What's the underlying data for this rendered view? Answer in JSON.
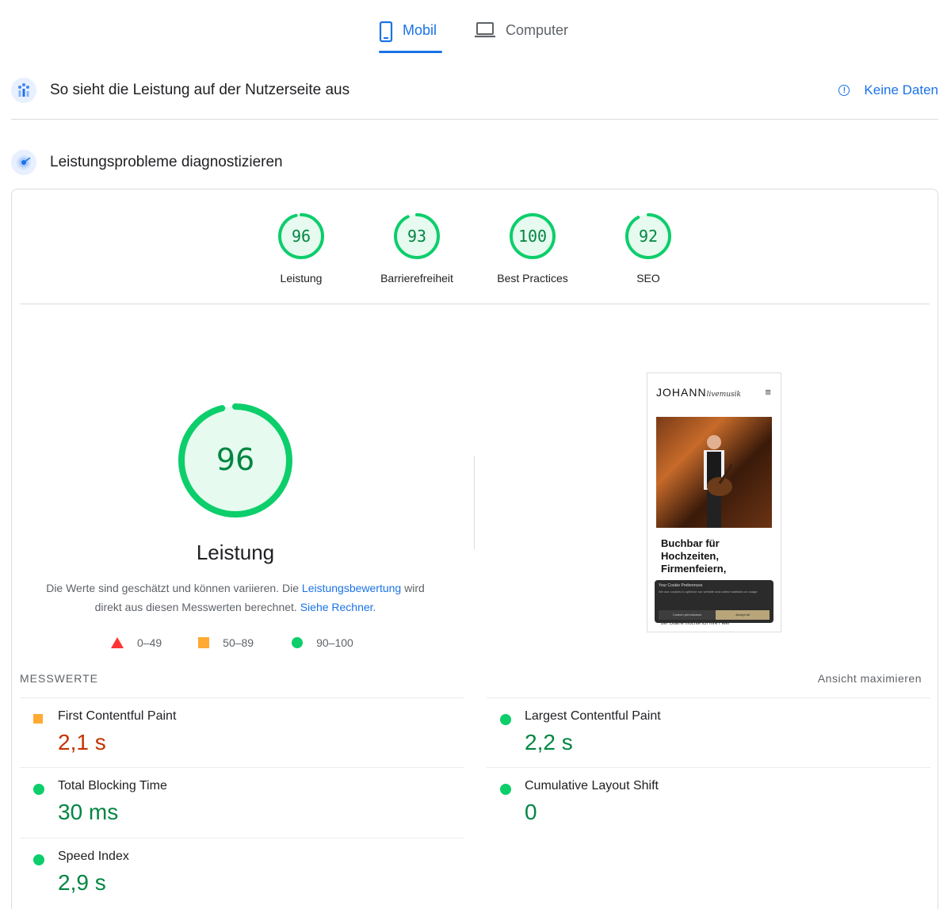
{
  "tabs": {
    "mobile_label": "Mobil",
    "computer_label": "Computer",
    "active": "mobile"
  },
  "field_section": {
    "icon": "users-chart-icon",
    "title": "So sieht die Leistung auf der Nutzerseite aus",
    "no_data_label": "Keine Daten",
    "info_glyph": "!"
  },
  "lab_section": {
    "icon": "radar-icon",
    "title": "Leistungsprobleme diagnostizieren"
  },
  "scores": [
    {
      "label": "Leistung",
      "value": "96",
      "fraction": 0.96
    },
    {
      "label": "Barrierefreiheit",
      "value": "93",
      "fraction": 0.93
    },
    {
      "label": "Best Practices",
      "value": "100",
      "fraction": 1.0
    },
    {
      "label": "SEO",
      "value": "92",
      "fraction": 0.92
    }
  ],
  "main_score": {
    "value": "96",
    "fraction": 0.96,
    "label": "Leistung",
    "desc_part1": "Die Werte sind geschätzt und können variieren. Die ",
    "desc_link1": "Leistungsbewertung",
    "desc_part2": " wird direkt aus diesen Messwerten berechnet. ",
    "desc_link2": "Siehe Rechner."
  },
  "legend": {
    "fail": "0–49",
    "average": "50–89",
    "pass": "90–100"
  },
  "colors": {
    "accent": "#1a73e8",
    "pass": "#0cce6b",
    "pass_text": "#018642",
    "average": "#ffaa33",
    "average_text": "#c33300",
    "fail": "#ff3333"
  },
  "preview": {
    "logo": "JOHANN",
    "logo_script": "livemusik",
    "menu_glyph": "≡",
    "headline": "Buchbar für Hochzeiten, Firmenfeiern,",
    "cookie_title": "Your Cookie Preferences",
    "cookie_text": "We use cookies to optimize our website and collect statistics on usage.",
    "cookie_btn_custom": "Custom permissions",
    "cookie_btn_accept": "Accept all",
    "footer_text": "der Gitarre möchte ich Ihre Feier"
  },
  "metrics": {
    "header": "MESSWERTE",
    "expand_label": "Ansicht maximieren",
    "items": [
      {
        "name": "First Contentful Paint",
        "value": "2,1 s",
        "status": "average"
      },
      {
        "name": "Largest Contentful Paint",
        "value": "2,2 s",
        "status": "pass"
      },
      {
        "name": "Total Blocking Time",
        "value": "30 ms",
        "status": "pass"
      },
      {
        "name": "Cumulative Layout Shift",
        "value": "0",
        "status": "pass"
      },
      {
        "name": "Speed Index",
        "value": "2,9 s",
        "status": "pass"
      }
    ]
  }
}
